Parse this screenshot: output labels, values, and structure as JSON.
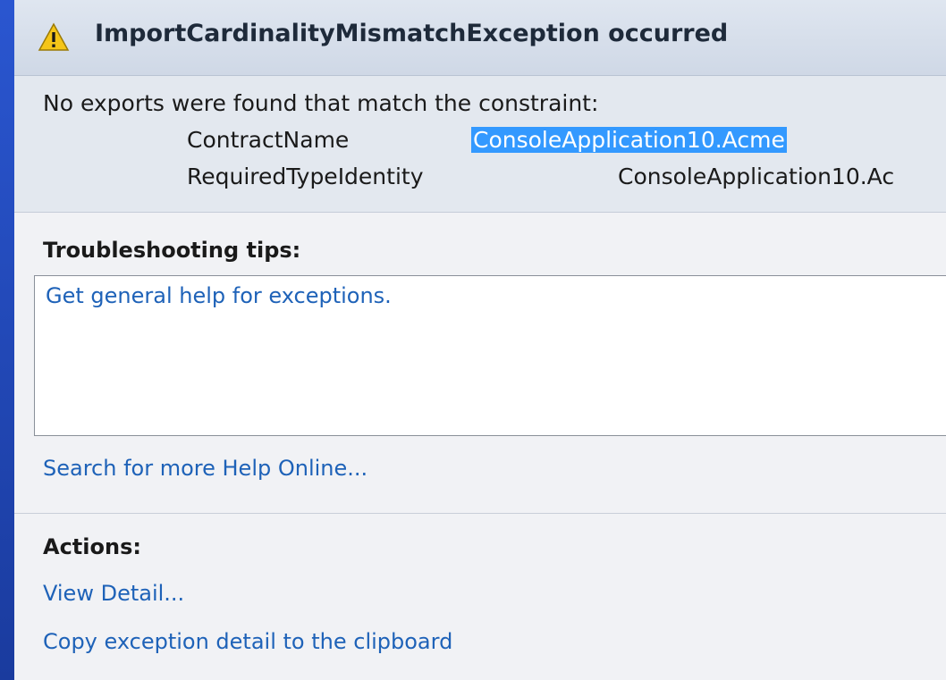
{
  "dialog": {
    "title": "ImportCardinalityMismatchException occurred",
    "message": {
      "intro": "No exports were found that match the constraint:",
      "rows": [
        {
          "key": "ContractName",
          "value": "ConsoleApplication10.Acme"
        },
        {
          "key": "RequiredTypeIdentity",
          "value": "ConsoleApplication10.Ac"
        }
      ]
    },
    "troubleshooting": {
      "label": "Troubleshooting tips:",
      "tips": [
        "Get general help for exceptions."
      ],
      "search_link": "Search for more Help Online..."
    },
    "actions": {
      "label": "Actions:",
      "items": [
        "View Detail...",
        "Copy exception detail to the clipboard"
      ]
    }
  },
  "colors": {
    "link": "#1e62b8",
    "selection": "#3399ff",
    "frame": "#1b3fa8"
  }
}
